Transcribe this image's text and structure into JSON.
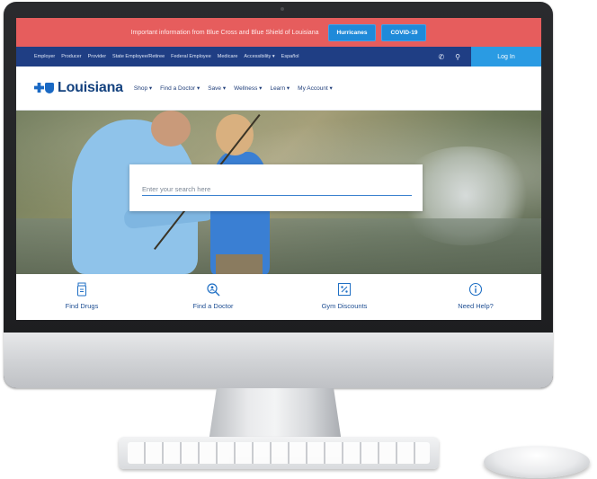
{
  "alert": {
    "text": "Important information from Blue Cross and Blue Shield of Louisiana",
    "buttons": [
      "Hurricanes",
      "COVID-19"
    ]
  },
  "topnav": {
    "items": [
      "Employer",
      "Producer",
      "Provider",
      "State Employee/Retiree",
      "Federal Employee",
      "Medicare",
      "Accessibility ▾",
      "Español"
    ],
    "login_label": "Log In",
    "icons": [
      "phone-icon",
      "search-icon"
    ]
  },
  "mainnav": {
    "logo_text": "Louisiana",
    "items": [
      "Shop ▾",
      "Find a Doctor ▾",
      "Save ▾",
      "Wellness ▾",
      "Learn ▾",
      "My Account ▾"
    ]
  },
  "hero": {
    "search_placeholder": "Enter your search here"
  },
  "quicklinks": [
    {
      "label": "Find Drugs",
      "icon": "prescription-bottle-icon"
    },
    {
      "label": "Find a Doctor",
      "icon": "magnifier-person-icon"
    },
    {
      "label": "Gym Discounts",
      "icon": "percent-tag-icon"
    },
    {
      "label": "Need Help?",
      "icon": "info-circle-icon"
    }
  ],
  "colors": {
    "alert_bg": "#e65d5d",
    "topnav_bg": "#1f3e84",
    "accent_blue": "#2a9be3",
    "brand_blue": "#1a69c4"
  }
}
